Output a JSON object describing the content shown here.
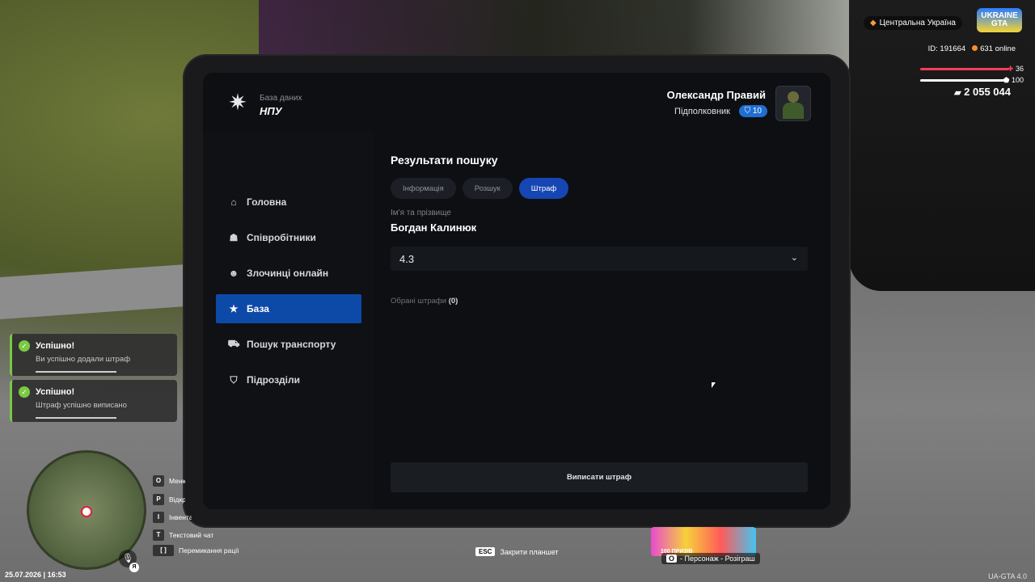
{
  "hud": {
    "region": "Центральна Україна",
    "logo_top": "UKRAINE",
    "logo_bottom": "GTA",
    "player_id": "ID: 191664",
    "online": "631 online",
    "health": "36",
    "armor": "100",
    "money": "2 055 044"
  },
  "tablet": {
    "brand_small": "База даних",
    "brand_big": "НПУ",
    "user_name": "Олександр Правий",
    "user_rank": "Підполковник",
    "user_level": "10",
    "nav": [
      {
        "label": "Головна",
        "active": false
      },
      {
        "label": "Співробітники",
        "active": false
      },
      {
        "label": "Злочинці онлайн",
        "active": false
      },
      {
        "label": "База",
        "active": true
      },
      {
        "label": "Пошук транспорту",
        "active": false
      },
      {
        "label": "Підрозділи",
        "active": false
      }
    ],
    "content": {
      "title": "Результати пошуку",
      "tabs": [
        {
          "label": "Інформація",
          "active": false
        },
        {
          "label": "Розшук",
          "active": false
        },
        {
          "label": "Штраф",
          "active": true
        }
      ],
      "name_label": "Ім'я та прізвище",
      "name_value": "Богдан Калинюк",
      "article_select": "4.3",
      "selected_label": "Обрані штрафи",
      "selected_count": "(0)",
      "issue_button": "Виписати штраф"
    }
  },
  "notifications": [
    {
      "title": "Успішно!",
      "message": "Ви успішно додали штраф"
    },
    {
      "title": "Успішно!",
      "message": "Штраф успішно виписано"
    }
  ],
  "hints": [
    {
      "key": "O",
      "label": "Меню"
    },
    {
      "key": "P",
      "label": "Відкрити"
    },
    {
      "key": "I",
      "label": "Інвентар"
    },
    {
      "key": "T",
      "label": "Текстовий чат"
    },
    {
      "key": "[ ]",
      "label": "Перемикання рації"
    }
  ],
  "mic_key": "Я",
  "datetime": "25.07.2026 | 16:53",
  "esc_key": "ESC",
  "esc_label": "Закрити планшет",
  "promo_text": "100 ПРИЗІВ",
  "character_hint_key": "O",
  "character_hint": "- Персонаж - Розіграш",
  "version": "UA-GTA 4.0",
  "icons": {
    "nav": [
      "home-icon",
      "employees-icon",
      "criminal-icon",
      "star-icon",
      "car-icon",
      "shield-icon"
    ]
  },
  "colors": {
    "accent": "#1646b4",
    "nav_active": "#0d4aa8",
    "success": "#7ac943",
    "health": "#ff3c57"
  }
}
